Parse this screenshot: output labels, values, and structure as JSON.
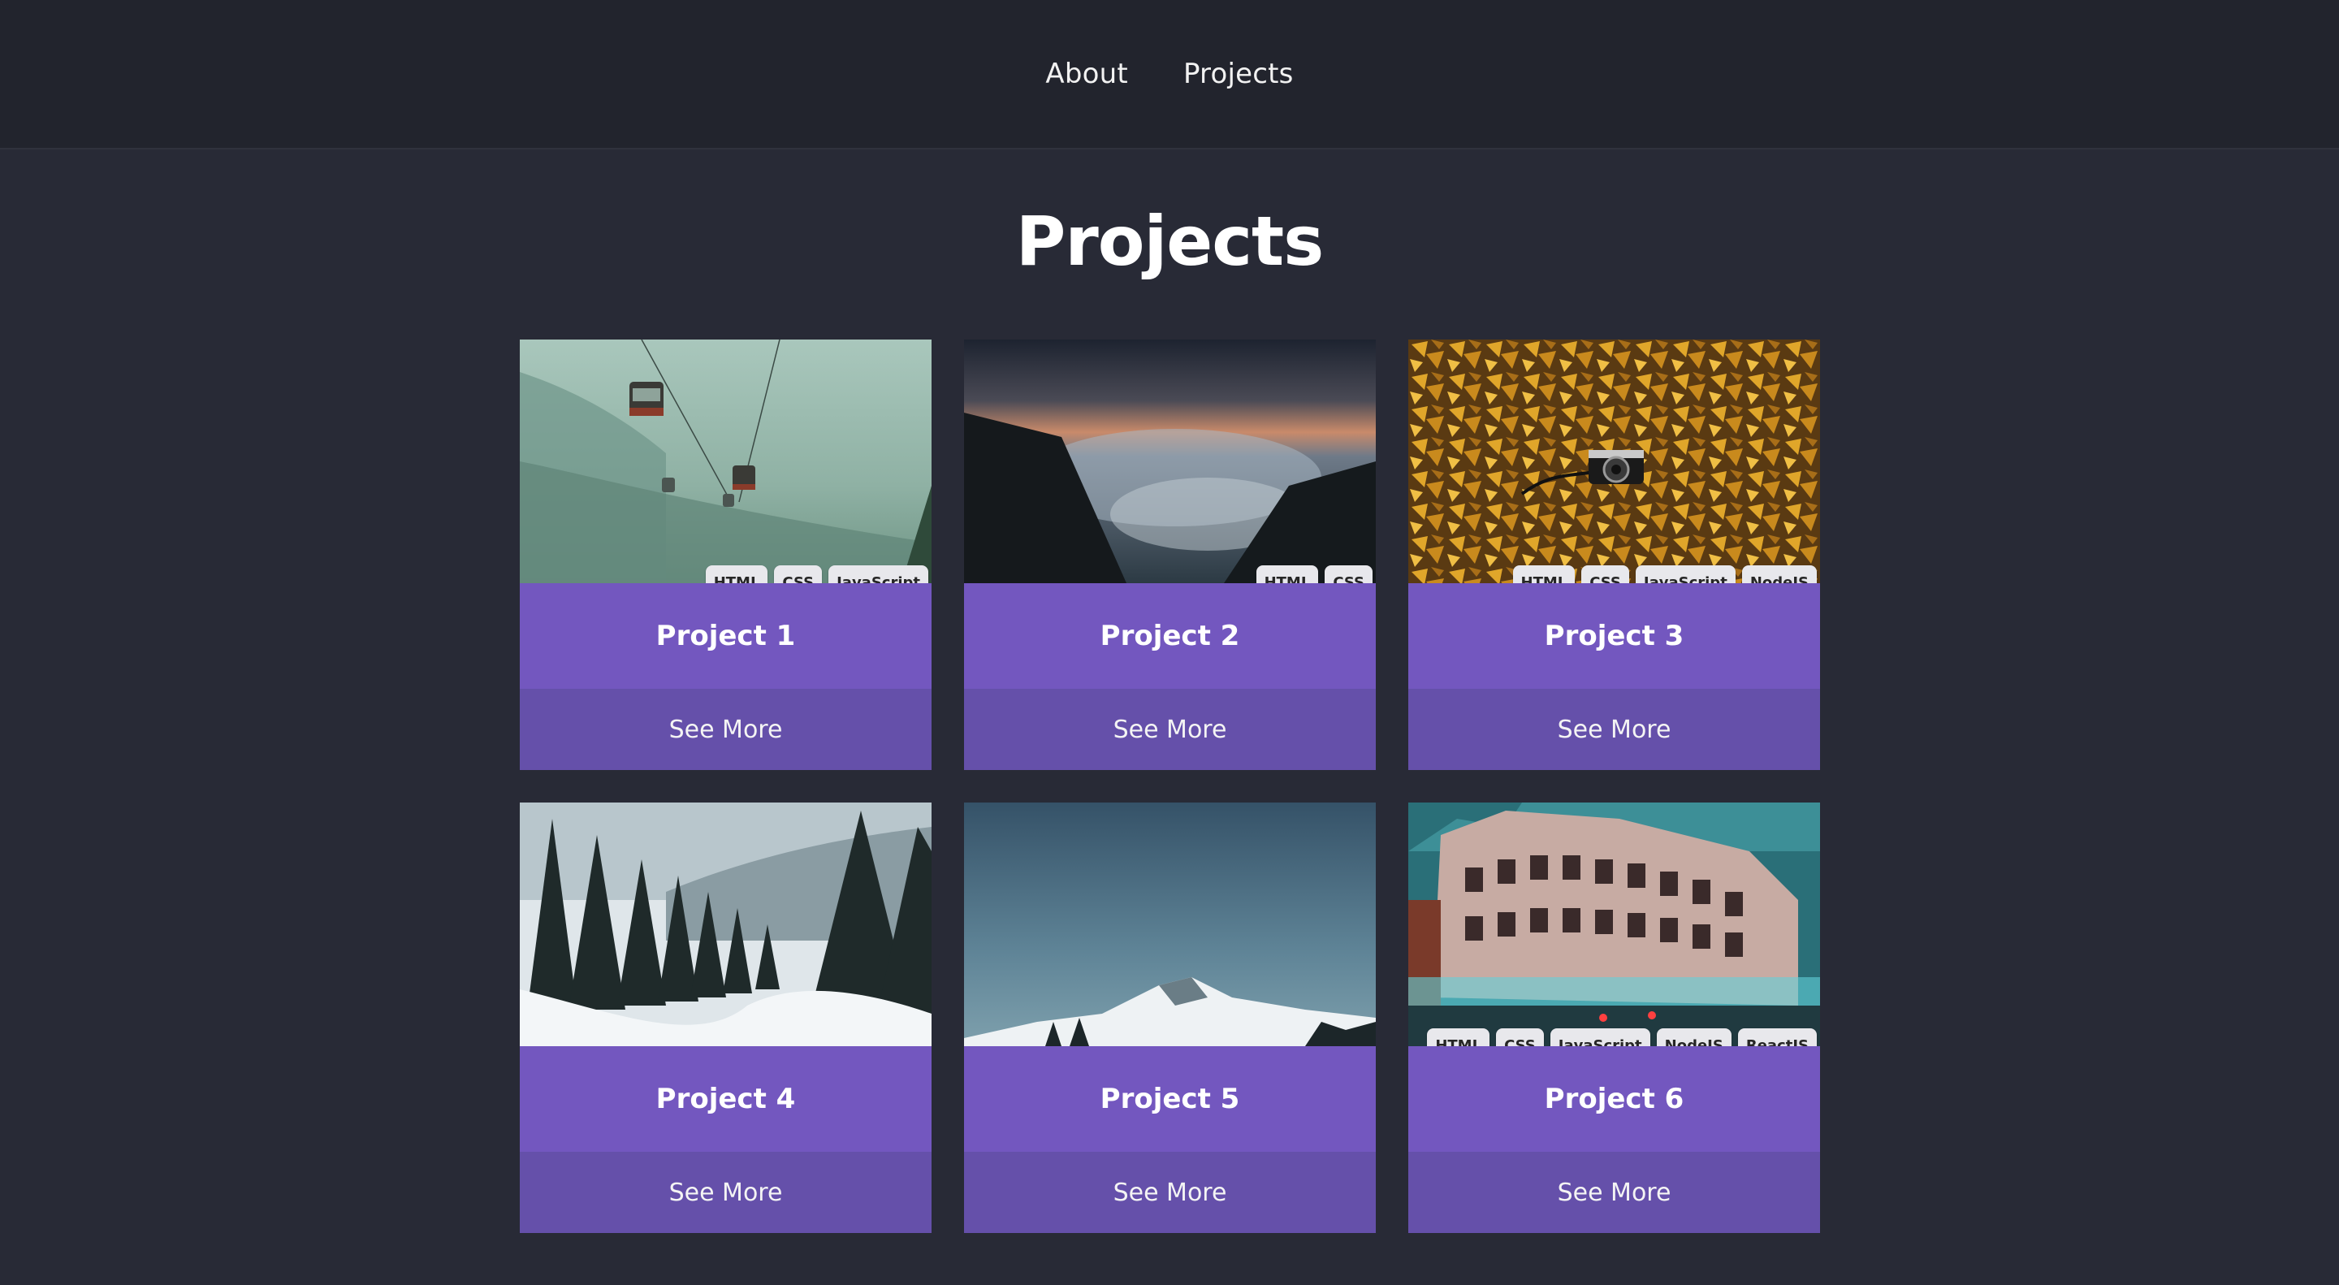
{
  "nav": {
    "items": [
      {
        "label": "About"
      },
      {
        "label": "Projects"
      }
    ]
  },
  "page": {
    "title": "Projects"
  },
  "projects": [
    {
      "title": "Project 1",
      "button": "See More",
      "tags": [
        "HTML",
        "CSS",
        "JavaScript"
      ],
      "image": "cable-car-misty-mountain-photo"
    },
    {
      "title": "Project 2",
      "button": "See More",
      "tags": [
        "HTML",
        "CSS"
      ],
      "image": "sunset-clouds-valley-photo"
    },
    {
      "title": "Project 3",
      "button": "See More",
      "tags": [
        "HTML",
        "CSS",
        "JavaScript",
        "NodeJS"
      ],
      "image": "camera-autumn-leaves-photo"
    },
    {
      "title": "Project 4",
      "button": "See More",
      "tags": [],
      "image": "snowy-forest-photo"
    },
    {
      "title": "Project 5",
      "button": "See More",
      "tags": [],
      "image": "snow-mountain-blue-sky-photo"
    },
    {
      "title": "Project 6",
      "button": "See More",
      "tags": [
        "HTML",
        "CSS",
        "JavaScript",
        "NodeJS",
        "ReactJS"
      ],
      "image": "ornate-building-street-photo"
    }
  ],
  "colors": {
    "background": "#282a36",
    "header": "#22242d",
    "card": "#7357bf",
    "button": "#6550aa",
    "tag": "#e8e8ec"
  }
}
